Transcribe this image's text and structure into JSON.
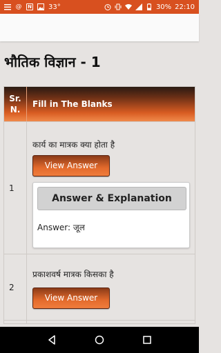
{
  "status_bar": {
    "temperature": "33°",
    "battery": "30%",
    "time": "22:10",
    "icons": [
      "list-icon",
      "at-icon",
      "n-icon",
      "image-icon",
      "alarm-icon",
      "vibrate-icon",
      "wifi-icon",
      "signal-icon",
      "battery-icon"
    ]
  },
  "page": {
    "title": "भौतिक विज्ञान - 1"
  },
  "table": {
    "header_sr_line1": "Sr.",
    "header_sr_line2": "N.",
    "header_question": "Fill in The Blanks",
    "rows": [
      {
        "sr": "1",
        "question": "कार्य का मात्रक क्या होता है",
        "view_label": "View Answer",
        "explanation_label": "Answer & Explanation",
        "answer": "Answer: जूल"
      },
      {
        "sr": "2",
        "question": "प्रकाशवर्ष मात्रक किसका है",
        "view_label": "View Answer"
      }
    ]
  },
  "nav": {
    "icons": [
      "back-icon",
      "home-icon",
      "recents-icon"
    ]
  }
}
